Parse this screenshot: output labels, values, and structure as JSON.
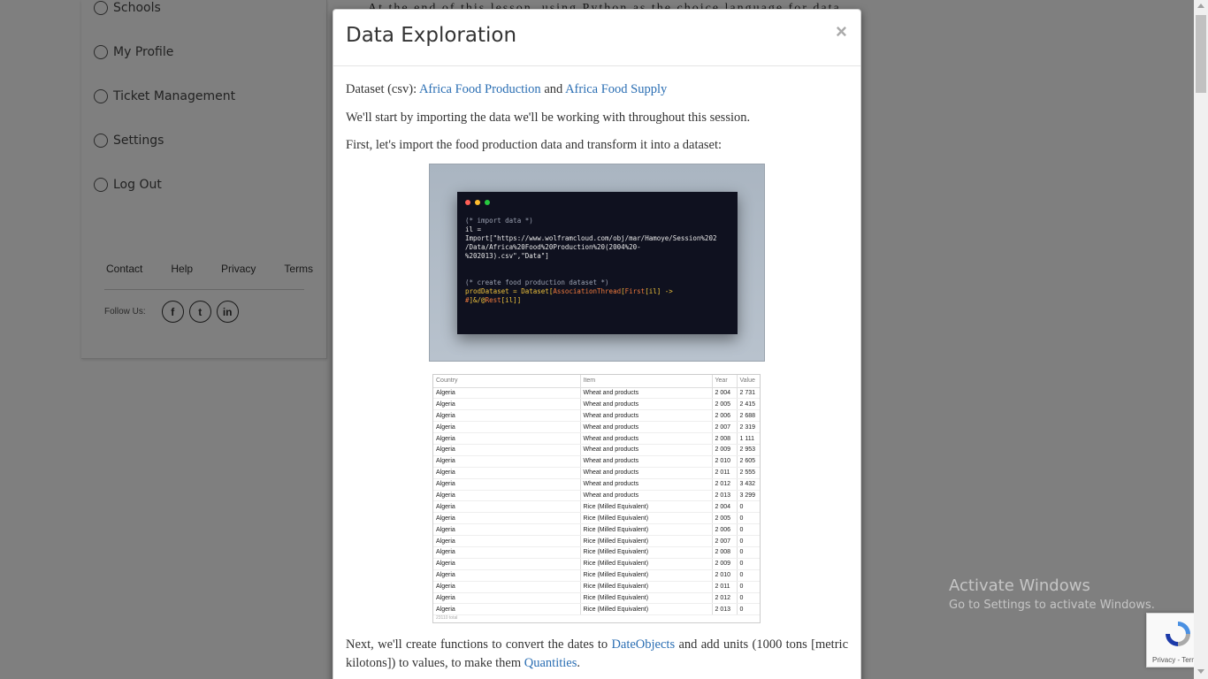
{
  "sidebar": {
    "items": [
      {
        "label": "Schools"
      },
      {
        "label": "My Profile"
      },
      {
        "label": "Ticket Management"
      },
      {
        "label": "Settings"
      },
      {
        "label": "Log Out"
      }
    ],
    "footer_links": [
      "Contact",
      "Help",
      "Privacy",
      "Terms"
    ],
    "follow_label": "Follow Us:",
    "social_icons": [
      "facebook-icon",
      "twitter-icon",
      "linkedin-icon"
    ],
    "social_glyphs": [
      "f",
      "t",
      "in"
    ]
  },
  "background_text": "At the end of this lesson, using Python as the choice language for data",
  "modal": {
    "title": "Data Exploration",
    "close": "×",
    "dataset_prefix": "Dataset (csv):",
    "link_production": "Africa Food Production",
    "and": "and",
    "link_supply": "Africa Food Supply",
    "para_import": "We'll start by importing the data we'll be working with throughout this session.",
    "para_first": "First, let's import the food production data and transform it into a dataset:",
    "code": {
      "line1": "(* import data *)",
      "line2": "il =",
      "line3": "Import[\"https://www.wolframcloud.com/obj/mar/Hamoye/Session%202",
      "line4": "/Data/Africa%20Food%20Production%20(2004%20-",
      "line5": "%202013).csv\",\"Data\"]",
      "line6": "(* create food production dataset *)",
      "line7a": "prodDataset = ",
      "line7b": "Dataset",
      "line7c": "[",
      "line7d": "AssociationThread",
      "line7e": "[",
      "line7f": "First",
      "line7g": "[il] ->",
      "line8a": "#",
      "line8b": "]&/@",
      "line8c": "Rest",
      "line8d": "[il]]"
    },
    "table": {
      "headers": [
        "Country",
        "Item",
        "Year",
        "Value"
      ],
      "rows": [
        [
          "Algeria",
          "Wheat and products",
          "2 004",
          "2 731"
        ],
        [
          "Algeria",
          "Wheat and products",
          "2 005",
          "2 415"
        ],
        [
          "Algeria",
          "Wheat and products",
          "2 006",
          "2 688"
        ],
        [
          "Algeria",
          "Wheat and products",
          "2 007",
          "2 319"
        ],
        [
          "Algeria",
          "Wheat and products",
          "2 008",
          "1 111"
        ],
        [
          "Algeria",
          "Wheat and products",
          "2 009",
          "2 953"
        ],
        [
          "Algeria",
          "Wheat and products",
          "2 010",
          "2 605"
        ],
        [
          "Algeria",
          "Wheat and products",
          "2 011",
          "2 555"
        ],
        [
          "Algeria",
          "Wheat and products",
          "2 012",
          "3 432"
        ],
        [
          "Algeria",
          "Wheat and products",
          "2 013",
          "3 299"
        ],
        [
          "Algeria",
          "Rice (Milled Equivalent)",
          "2 004",
          "0"
        ],
        [
          "Algeria",
          "Rice (Milled Equivalent)",
          "2 005",
          "0"
        ],
        [
          "Algeria",
          "Rice (Milled Equivalent)",
          "2 006",
          "0"
        ],
        [
          "Algeria",
          "Rice (Milled Equivalent)",
          "2 007",
          "0"
        ],
        [
          "Algeria",
          "Rice (Milled Equivalent)",
          "2 008",
          "0"
        ],
        [
          "Algeria",
          "Rice (Milled Equivalent)",
          "2 009",
          "0"
        ],
        [
          "Algeria",
          "Rice (Milled Equivalent)",
          "2 010",
          "0"
        ],
        [
          "Algeria",
          "Rice (Milled Equivalent)",
          "2 011",
          "0"
        ],
        [
          "Algeria",
          "Rice (Milled Equivalent)",
          "2 012",
          "0"
        ],
        [
          "Algeria",
          "Rice (Milled Equivalent)",
          "2 013",
          "0"
        ]
      ],
      "footer": "23110 total"
    },
    "para_next_a": "Next, we'll create functions to convert the dates to",
    "link_dateobjects": "DateObjects",
    "para_next_b": "and add units (1000 tons [metric kilotons]) to values, to make them",
    "link_quantities": "Quantities",
    "para_next_c": "."
  },
  "windows_watermark": {
    "line1": "Activate Windows",
    "line2": "Go to Settings to activate Windows."
  },
  "recaptcha": {
    "text": "Privacy - Terms"
  },
  "colors": {
    "link": "#2a6eb3",
    "code_bg": "#0f111f",
    "dot_red": "#ff5f56",
    "dot_yellow": "#ffbd2e",
    "dot_green": "#27c93f"
  }
}
